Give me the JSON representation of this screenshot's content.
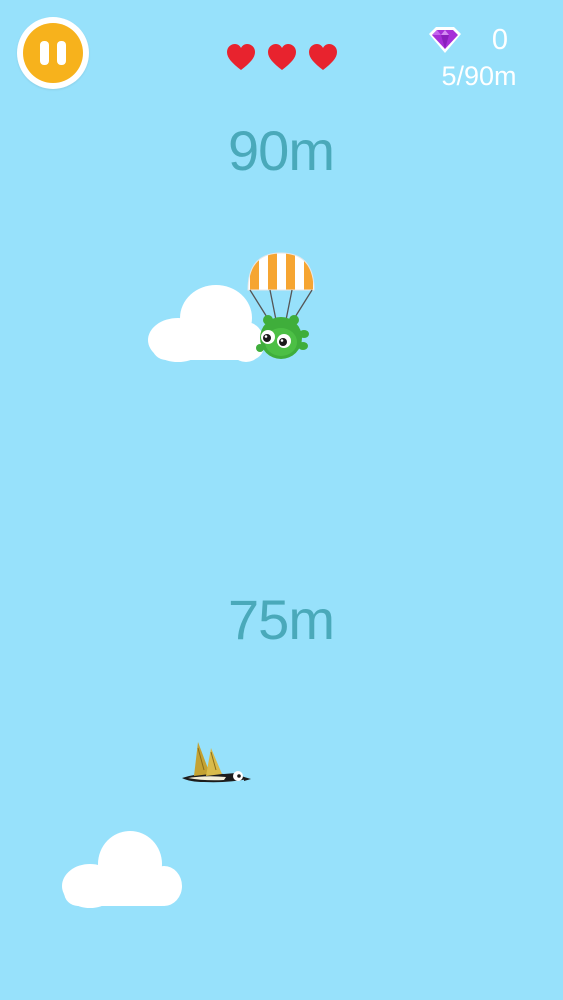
{
  "hud": {
    "pause_icon": "pause-icon",
    "lives": [
      {
        "icon": "heart-icon",
        "color": "#e8232e"
      },
      {
        "icon": "heart-icon",
        "color": "#e8232e"
      },
      {
        "icon": "heart-icon",
        "color": "#e8232e"
      }
    ],
    "gem_icon": "gem-icon",
    "gem_color": "#a62ed8",
    "gem_count": "0",
    "distance_progress": "5/90m"
  },
  "world": {
    "altitude_markers": [
      "90m",
      "75m"
    ],
    "sky_color": "#97e1fb",
    "player": "frog-with-parachute",
    "enemy": "duck"
  }
}
